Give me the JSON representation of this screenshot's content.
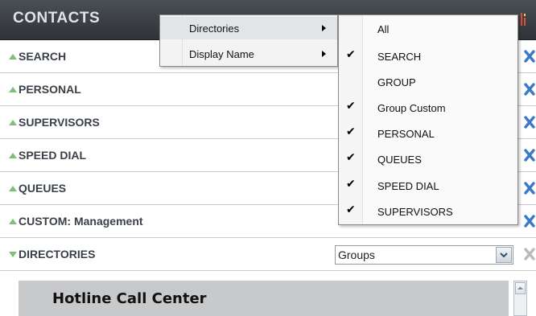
{
  "header": {
    "title": "CONTACTS"
  },
  "rows": [
    {
      "label": "SEARCH",
      "state": "collapsed"
    },
    {
      "label": "PERSONAL",
      "state": "collapsed"
    },
    {
      "label": "SUPERVISORS",
      "state": "collapsed"
    },
    {
      "label": "SPEED DIAL",
      "state": "collapsed"
    },
    {
      "label": "QUEUES",
      "state": "collapsed"
    },
    {
      "label": "CUSTOM: Management",
      "state": "collapsed"
    },
    {
      "label": "DIRECTORIES",
      "state": "expanded"
    }
  ],
  "directories": {
    "select_value": "Groups",
    "first_entry": "Hotline Call Center"
  },
  "context_menu": {
    "items": [
      {
        "label": "Directories",
        "has_submenu": true,
        "highlighted": true
      },
      {
        "label": "Display Name",
        "has_submenu": true,
        "highlighted": false
      }
    ]
  },
  "submenu": {
    "items": [
      {
        "label": "All",
        "checked": false
      },
      {
        "label": "SEARCH",
        "checked": true
      },
      {
        "label": "GROUP",
        "checked": false
      },
      {
        "label": "Group Custom",
        "checked": true
      },
      {
        "label": "PERSONAL",
        "checked": true
      },
      {
        "label": "QUEUES",
        "checked": true
      },
      {
        "label": "SPEED DIAL",
        "checked": true
      },
      {
        "label": "SUPERVISORS",
        "checked": true
      }
    ],
    "check_glyph": "✔"
  },
  "colors": {
    "header_bg": "#3d4248",
    "expand_arrow": "#7ac07a",
    "close_blue": "#3b78c7",
    "close_gray": "#b8bcbf"
  }
}
